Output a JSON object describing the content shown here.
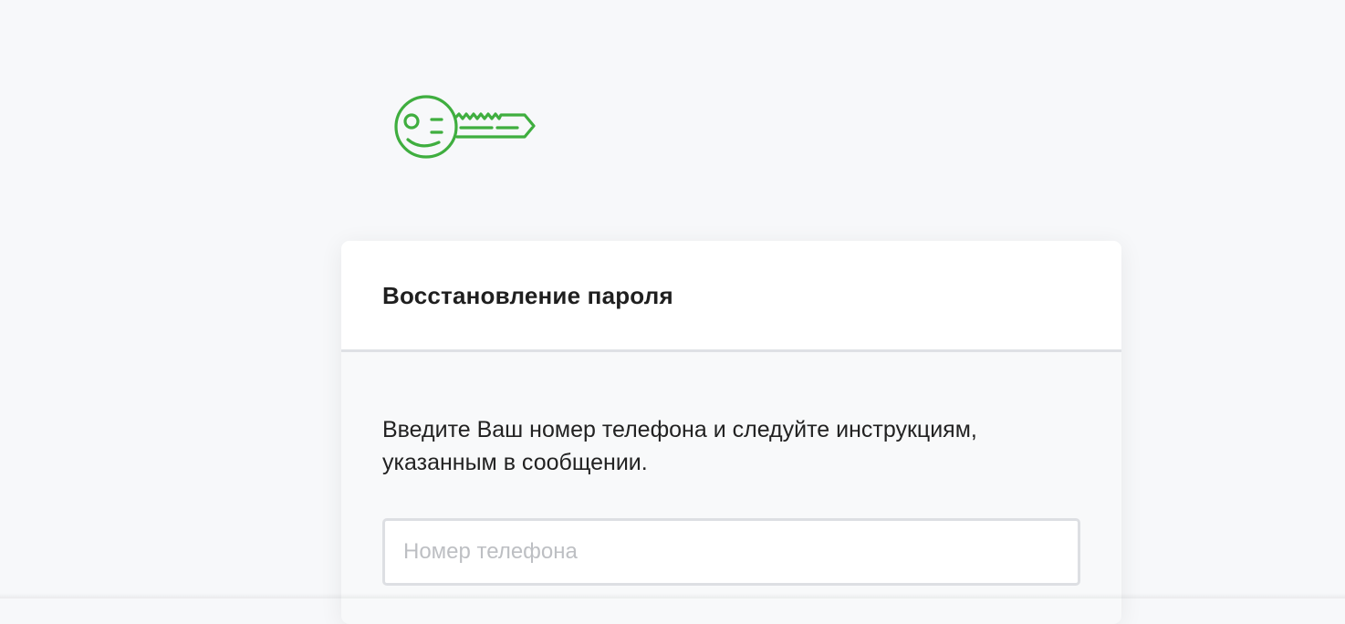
{
  "logo": {
    "icon": "smiling-key-icon",
    "color": "#3fae3f"
  },
  "form": {
    "title": "Восстановление пароля",
    "instructions": "Введите Ваш номер телефона и следуйте инструкциям, указанным в сообщении.",
    "phone": {
      "value": "",
      "placeholder": "Номер телефона"
    }
  },
  "colors": {
    "background": "#f7f8fa",
    "card_header": "#ffffff",
    "accent": "#3fae3f",
    "divider": "#dfe1e5"
  }
}
